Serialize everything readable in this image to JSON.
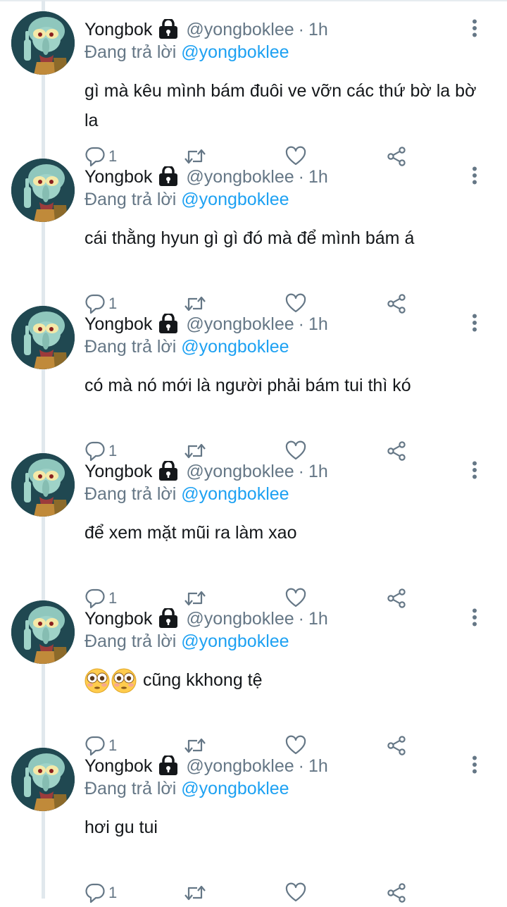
{
  "tweets": [
    {
      "name": "Yongbok",
      "handle": "@yongboklee",
      "separator": "·",
      "time": "1h",
      "reply_label": "Đang trả lời",
      "reply_handle": "@yongboklee",
      "text": "gì mà kêu mình bám đuôi ve vỡn các thứ bờ la bờ la",
      "reply_count": "1"
    },
    {
      "name": "Yongbok",
      "handle": "@yongboklee",
      "separator": "·",
      "time": "1h",
      "reply_label": "Đang trả lời",
      "reply_handle": "@yongboklee",
      "text": "cái thằng hyun gì gì đó mà để mình bám á",
      "reply_count": "1"
    },
    {
      "name": "Yongbok",
      "handle": "@yongboklee",
      "separator": "·",
      "time": "1h",
      "reply_label": "Đang trả lời",
      "reply_handle": "@yongboklee",
      "text": "có mà nó mới là người phải bám tui thì kó",
      "reply_count": "1"
    },
    {
      "name": "Yongbok",
      "handle": "@yongboklee",
      "separator": "·",
      "time": "1h",
      "reply_label": "Đang trả lời",
      "reply_handle": "@yongboklee",
      "text": "để xem mặt mũi ra làm xao",
      "reply_count": "1"
    },
    {
      "name": "Yongbok",
      "handle": "@yongboklee",
      "separator": "·",
      "time": "1h",
      "reply_label": "Đang trả lời",
      "reply_handle": "@yongboklee",
      "text": "cũng kkhong tệ",
      "emoji_prefix": [
        "flushed-face",
        "flushed-face"
      ],
      "reply_count": "1"
    },
    {
      "name": "Yongbok",
      "handle": "@yongboklee",
      "separator": "·",
      "time": "1h",
      "reply_label": "Đang trả lời",
      "reply_handle": "@yongboklee",
      "text": "hơi gu tui",
      "reply_count": "1"
    }
  ],
  "icons": {
    "lock": "lock-icon",
    "more": "more-vertical-icon",
    "reply": "reply-icon",
    "retweet": "retweet-icon",
    "like": "heart-icon",
    "share": "share-icon"
  },
  "colors": {
    "text": "#14171a",
    "secondary": "#657786",
    "link": "#1da1f2",
    "thread_line": "#e1e8ed"
  }
}
